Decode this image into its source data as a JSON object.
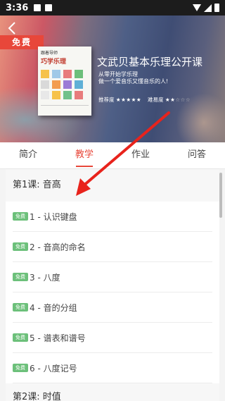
{
  "status_bar": {
    "time": "3:36"
  },
  "banner": {
    "back_icon": "chevron-left-icon",
    "free_label": "免费",
    "book_small_title": "跟着导师",
    "book_title": "巧学乐理",
    "book_grid_colors": [
      "#f6c24b",
      "#a0c9e8",
      "#e87c7c",
      "#6bbf7a",
      "#d9d9d9",
      "#f39c50",
      "#9b7bd6",
      "#5fb0d6",
      "#e8e8e8",
      "#f6c24b",
      "#71c18a",
      "#e87c7c"
    ],
    "course_title": "文武贝基本乐理公开课",
    "subtitle_line1": "从零开始学乐理",
    "subtitle_line2": "做一个爱音乐又懂音乐的人!",
    "recommend_label": "推荐度",
    "recommend_stars": 5,
    "difficulty_label": "难易度",
    "difficulty_stars": 2,
    "total_stars": 5
  },
  "tabs": [
    {
      "label": "简介",
      "active": false
    },
    {
      "label": "教学",
      "active": true
    },
    {
      "label": "作业",
      "active": false
    },
    {
      "label": "问答",
      "active": false
    }
  ],
  "accent_color": "#e8473a",
  "badge_color": "#6cc07a",
  "lesson1": {
    "title": "第1课: 音高",
    "items": [
      {
        "badge": "免费",
        "label": "1 - 认识键盘"
      },
      {
        "badge": "免费",
        "label": "2 - 音高的命名"
      },
      {
        "badge": "免费",
        "label": "3 - 八度"
      },
      {
        "badge": "免费",
        "label": "4 - 音的分组"
      },
      {
        "badge": "免费",
        "label": "5 - 谱表和谱号"
      },
      {
        "badge": "免费",
        "label": "6 - 八度记号"
      }
    ]
  },
  "lesson2": {
    "title": "第2课: 时值"
  },
  "annotation": {
    "arrow_color": "#e8231c"
  }
}
